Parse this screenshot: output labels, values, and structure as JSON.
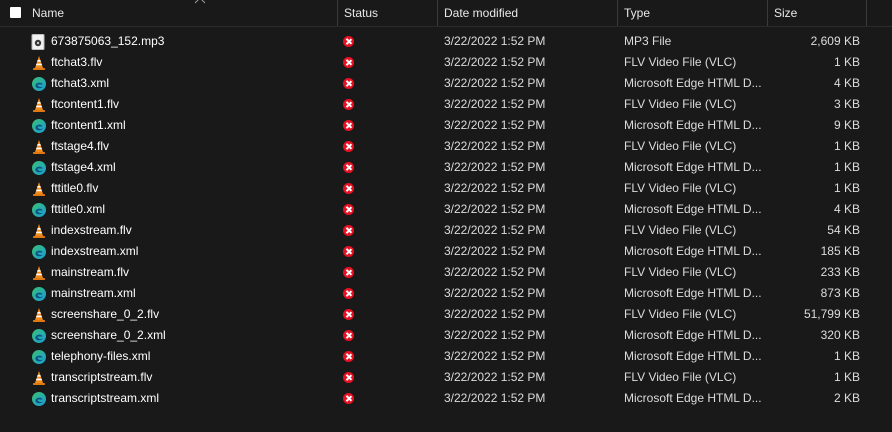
{
  "columns": {
    "name": "Name",
    "status": "Status",
    "date": "Date modified",
    "type": "Type",
    "size": "Size"
  },
  "colors": {
    "background": "#191919",
    "status_error": "#e81123",
    "vlc_orange": "#f08c1e",
    "edge_blue": "#1a9bd8",
    "edge_green": "#38c172"
  },
  "files": [
    {
      "name": "673875063_152.mp3",
      "icon": "mp3-file-icon",
      "status": "sync-error-icon",
      "date": "3/22/2022 1:52 PM",
      "type": "MP3 File",
      "size": "2,609 KB"
    },
    {
      "name": "ftchat3.flv",
      "icon": "vlc-cone-icon",
      "status": "sync-error-icon",
      "date": "3/22/2022 1:52 PM",
      "type": "FLV Video File (VLC)",
      "size": "1 KB"
    },
    {
      "name": "ftchat3.xml",
      "icon": "edge-icon",
      "status": "sync-error-icon",
      "date": "3/22/2022 1:52 PM",
      "type": "Microsoft Edge HTML D...",
      "size": "4 KB"
    },
    {
      "name": "ftcontent1.flv",
      "icon": "vlc-cone-icon",
      "status": "sync-error-icon",
      "date": "3/22/2022 1:52 PM",
      "type": "FLV Video File (VLC)",
      "size": "3 KB"
    },
    {
      "name": "ftcontent1.xml",
      "icon": "edge-icon",
      "status": "sync-error-icon",
      "date": "3/22/2022 1:52 PM",
      "type": "Microsoft Edge HTML D...",
      "size": "9 KB"
    },
    {
      "name": "ftstage4.flv",
      "icon": "vlc-cone-icon",
      "status": "sync-error-icon",
      "date": "3/22/2022 1:52 PM",
      "type": "FLV Video File (VLC)",
      "size": "1 KB"
    },
    {
      "name": "ftstage4.xml",
      "icon": "edge-icon",
      "status": "sync-error-icon",
      "date": "3/22/2022 1:52 PM",
      "type": "Microsoft Edge HTML D...",
      "size": "1 KB"
    },
    {
      "name": "fttitle0.flv",
      "icon": "vlc-cone-icon",
      "status": "sync-error-icon",
      "date": "3/22/2022 1:52 PM",
      "type": "FLV Video File (VLC)",
      "size": "1 KB"
    },
    {
      "name": "fttitle0.xml",
      "icon": "edge-icon",
      "status": "sync-error-icon",
      "date": "3/22/2022 1:52 PM",
      "type": "Microsoft Edge HTML D...",
      "size": "4 KB"
    },
    {
      "name": "indexstream.flv",
      "icon": "vlc-cone-icon",
      "status": "sync-error-icon",
      "date": "3/22/2022 1:52 PM",
      "type": "FLV Video File (VLC)",
      "size": "54 KB"
    },
    {
      "name": "indexstream.xml",
      "icon": "edge-icon",
      "status": "sync-error-icon",
      "date": "3/22/2022 1:52 PM",
      "type": "Microsoft Edge HTML D...",
      "size": "185 KB"
    },
    {
      "name": "mainstream.flv",
      "icon": "vlc-cone-icon",
      "status": "sync-error-icon",
      "date": "3/22/2022 1:52 PM",
      "type": "FLV Video File (VLC)",
      "size": "233 KB"
    },
    {
      "name": "mainstream.xml",
      "icon": "edge-icon",
      "status": "sync-error-icon",
      "date": "3/22/2022 1:52 PM",
      "type": "Microsoft Edge HTML D...",
      "size": "873 KB"
    },
    {
      "name": "screenshare_0_2.flv",
      "icon": "vlc-cone-icon",
      "status": "sync-error-icon",
      "date": "3/22/2022 1:52 PM",
      "type": "FLV Video File (VLC)",
      "size": "51,799 KB"
    },
    {
      "name": "screenshare_0_2.xml",
      "icon": "edge-icon",
      "status": "sync-error-icon",
      "date": "3/22/2022 1:52 PM",
      "type": "Microsoft Edge HTML D...",
      "size": "320 KB"
    },
    {
      "name": "telephony-files.xml",
      "icon": "edge-icon",
      "status": "sync-error-icon",
      "date": "3/22/2022 1:52 PM",
      "type": "Microsoft Edge HTML D...",
      "size": "1 KB"
    },
    {
      "name": "transcriptstream.flv",
      "icon": "vlc-cone-icon",
      "status": "sync-error-icon",
      "date": "3/22/2022 1:52 PM",
      "type": "FLV Video File (VLC)",
      "size": "1 KB"
    },
    {
      "name": "transcriptstream.xml",
      "icon": "edge-icon",
      "status": "sync-error-icon",
      "date": "3/22/2022 1:52 PM",
      "type": "Microsoft Edge HTML D...",
      "size": "2 KB"
    }
  ]
}
